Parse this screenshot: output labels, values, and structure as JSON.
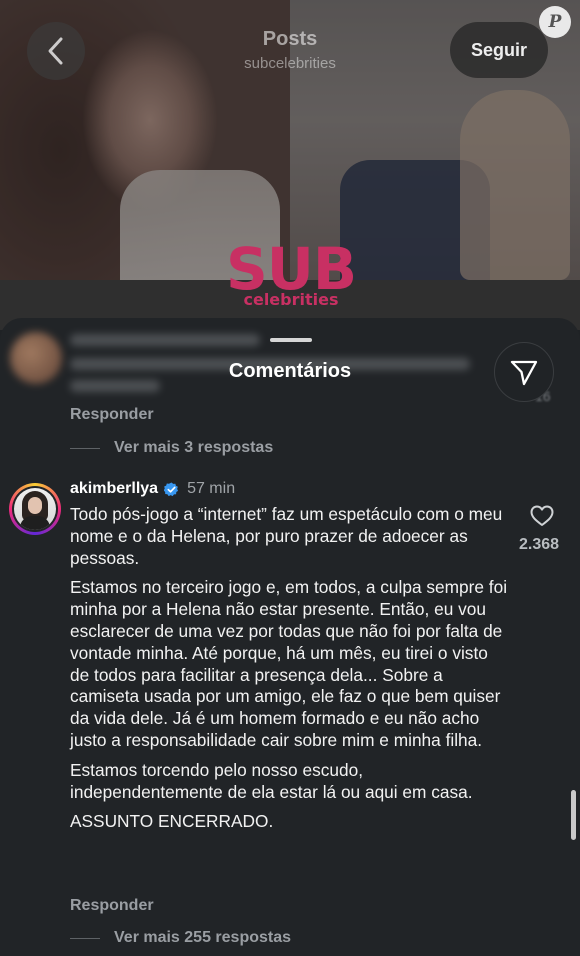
{
  "header": {
    "title": "Posts",
    "subtitle": "subcelebrities",
    "follow_label": "Seguir",
    "watermark_logo": "P",
    "brand_main": "SUB",
    "brand_sub": "celebrities"
  },
  "sheet": {
    "title": "Comentários"
  },
  "previous_comment": {
    "reply_label": "Responder",
    "more_replies_label": "Ver mais 3 respostas",
    "like_count_partial": "16"
  },
  "comment": {
    "username": "akimberllya",
    "verified": true,
    "time": "57 min",
    "paragraphs": [
      "Todo pós-jogo a “internet” faz um espetáculo com o meu nome e o da Helena, por puro prazer de adoecer as pessoas.",
      "Estamos no terceiro jogo e, em todos, a culpa sempre foi minha por a Helena não estar presente. Então, eu vou esclarecer de uma vez por todas que não foi por falta de vontade minha. Até porque, há um mês, eu tirei o visto de todos para facilitar a presença dela... Sobre a camiseta usada por um amigo, ele faz o que bem quiser da vida dele. Já é um homem formado e eu não acho justo a responsabilidade cair sobre mim e minha filha.",
      "Estamos torcendo pelo nosso escudo, independentemente de ela estar lá ou aqui em casa.",
      "ASSUNTO ENCERRADO."
    ],
    "like_count": "2.368",
    "reply_label": "Responder",
    "more_replies_label": "Ver mais 255 respostas"
  },
  "colors": {
    "sheet_bg": "#212427",
    "brand": "#c83063",
    "verified": "#3897f0",
    "muted_text": "#9a9ea3"
  },
  "icons": [
    "back-arrow-icon",
    "share-send-icon",
    "verified-badge-icon",
    "heart-icon"
  ]
}
